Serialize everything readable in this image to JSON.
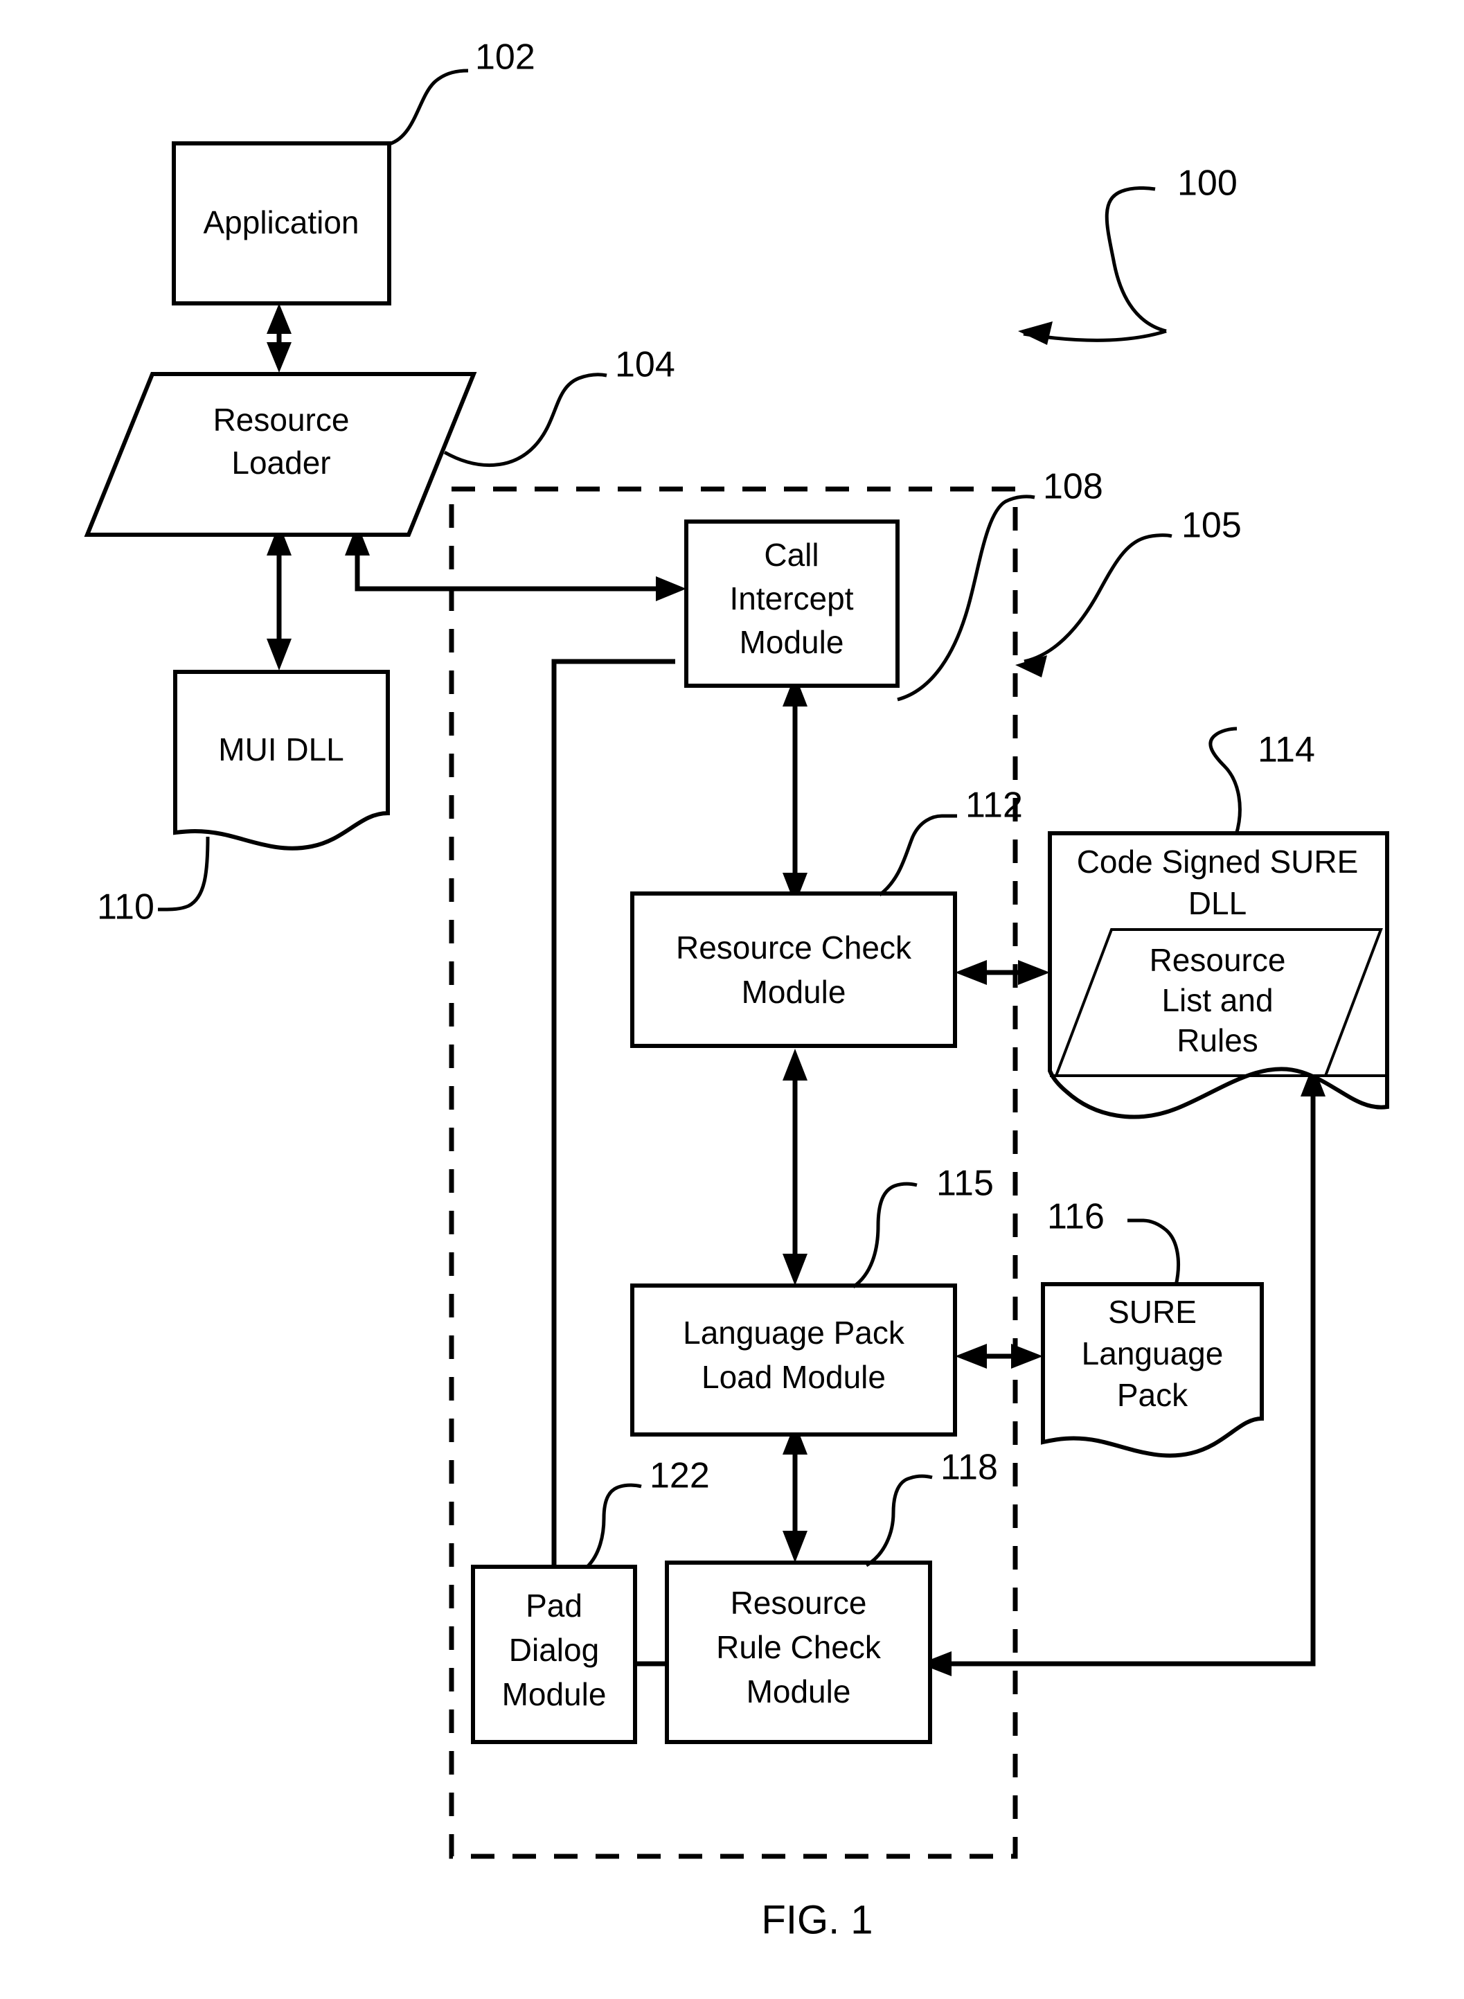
{
  "figure": {
    "caption": "FIG. 1",
    "system_ref": "100"
  },
  "nodes": [
    {
      "id": "application",
      "label": "Application",
      "lines": [
        "Application"
      ],
      "shape": "rectangle",
      "ref": "102"
    },
    {
      "id": "resource_loader",
      "label": "Resource Loader",
      "lines": [
        "Resource",
        "Loader"
      ],
      "shape": "parallelogram",
      "ref": "104"
    },
    {
      "id": "mui_dll",
      "label": "MUI DLL",
      "lines": [
        "MUI DLL"
      ],
      "shape": "document",
      "ref": "110"
    },
    {
      "id": "call_intercept",
      "label": "Call Intercept Module",
      "lines": [
        "Call",
        "Intercept",
        "Module"
      ],
      "shape": "rectangle",
      "ref": "108"
    },
    {
      "id": "resource_check",
      "label": "Resource Check Module",
      "lines": [
        "Resource Check",
        "Module"
      ],
      "shape": "rectangle",
      "ref": "112"
    },
    {
      "id": "lang_pack_load",
      "label": "Language Pack Load Module",
      "lines": [
        "Language Pack",
        "Load Module"
      ],
      "shape": "rectangle",
      "ref": "115"
    },
    {
      "id": "pad_dialog",
      "label": "Pad Dialog Module",
      "lines": [
        "Pad",
        "Dialog",
        "Module"
      ],
      "shape": "rectangle",
      "ref": "122"
    },
    {
      "id": "resource_rule",
      "label": "Resource Rule Check Module",
      "lines": [
        "Resource",
        "Rule Check",
        "Module"
      ],
      "shape": "rectangle",
      "ref": "118"
    },
    {
      "id": "sure_dll",
      "label": "Code Signed SURE DLL",
      "lines": [
        "Code Signed SURE",
        "DLL"
      ],
      "shape": "document",
      "ref": "114"
    },
    {
      "id": "resource_list",
      "label": "Resource List and Rules",
      "lines": [
        "Resource",
        "List and",
        "Rules"
      ],
      "shape": "parallelogram",
      "ref": ""
    },
    {
      "id": "sure_lang_pack",
      "label": "SURE Language Pack",
      "lines": [
        "SURE",
        "Language",
        "Pack"
      ],
      "shape": "document",
      "ref": "116"
    }
  ],
  "boundary": {
    "id": "sure_subsystem_boundary",
    "ref": "105",
    "style": "dashed"
  },
  "reference_numerals": {
    "system": "100",
    "application": "102",
    "resource_loader": "104",
    "boundary": "105",
    "call_intercept": "108",
    "mui_dll": "110",
    "resource_check": "112",
    "sure_dll": "114",
    "lang_pack_load": "115",
    "sure_lang_pack": "116",
    "resource_rule": "118",
    "pad_dialog": "122"
  },
  "text": {
    "application": "Application",
    "resource_l1": "Resource",
    "resource_l2": "Loader",
    "mui_dll": "MUI DLL",
    "call_l1": "Call",
    "call_l2": "Intercept",
    "call_l3": "Module",
    "rescheck_l1": "Resource Check",
    "rescheck_l2": "Module",
    "langpack_l1": "Language Pack",
    "langpack_l2": "Load Module",
    "pad_l1": "Pad",
    "pad_l2": "Dialog",
    "pad_l3": "Module",
    "rulecheck_l1": "Resource",
    "rulecheck_l2": "Rule Check",
    "rulecheck_l3": "Module",
    "suredll_l1": "Code Signed SURE",
    "suredll_l2": "DLL",
    "reslist_l1": "Resource",
    "reslist_l2": "List and",
    "reslist_l3": "Rules",
    "surelp_l1": "SURE",
    "surelp_l2": "Language",
    "surelp_l3": "Pack",
    "caption": "FIG. 1"
  },
  "colors": {
    "stroke": "#000000",
    "background": "#ffffff"
  }
}
